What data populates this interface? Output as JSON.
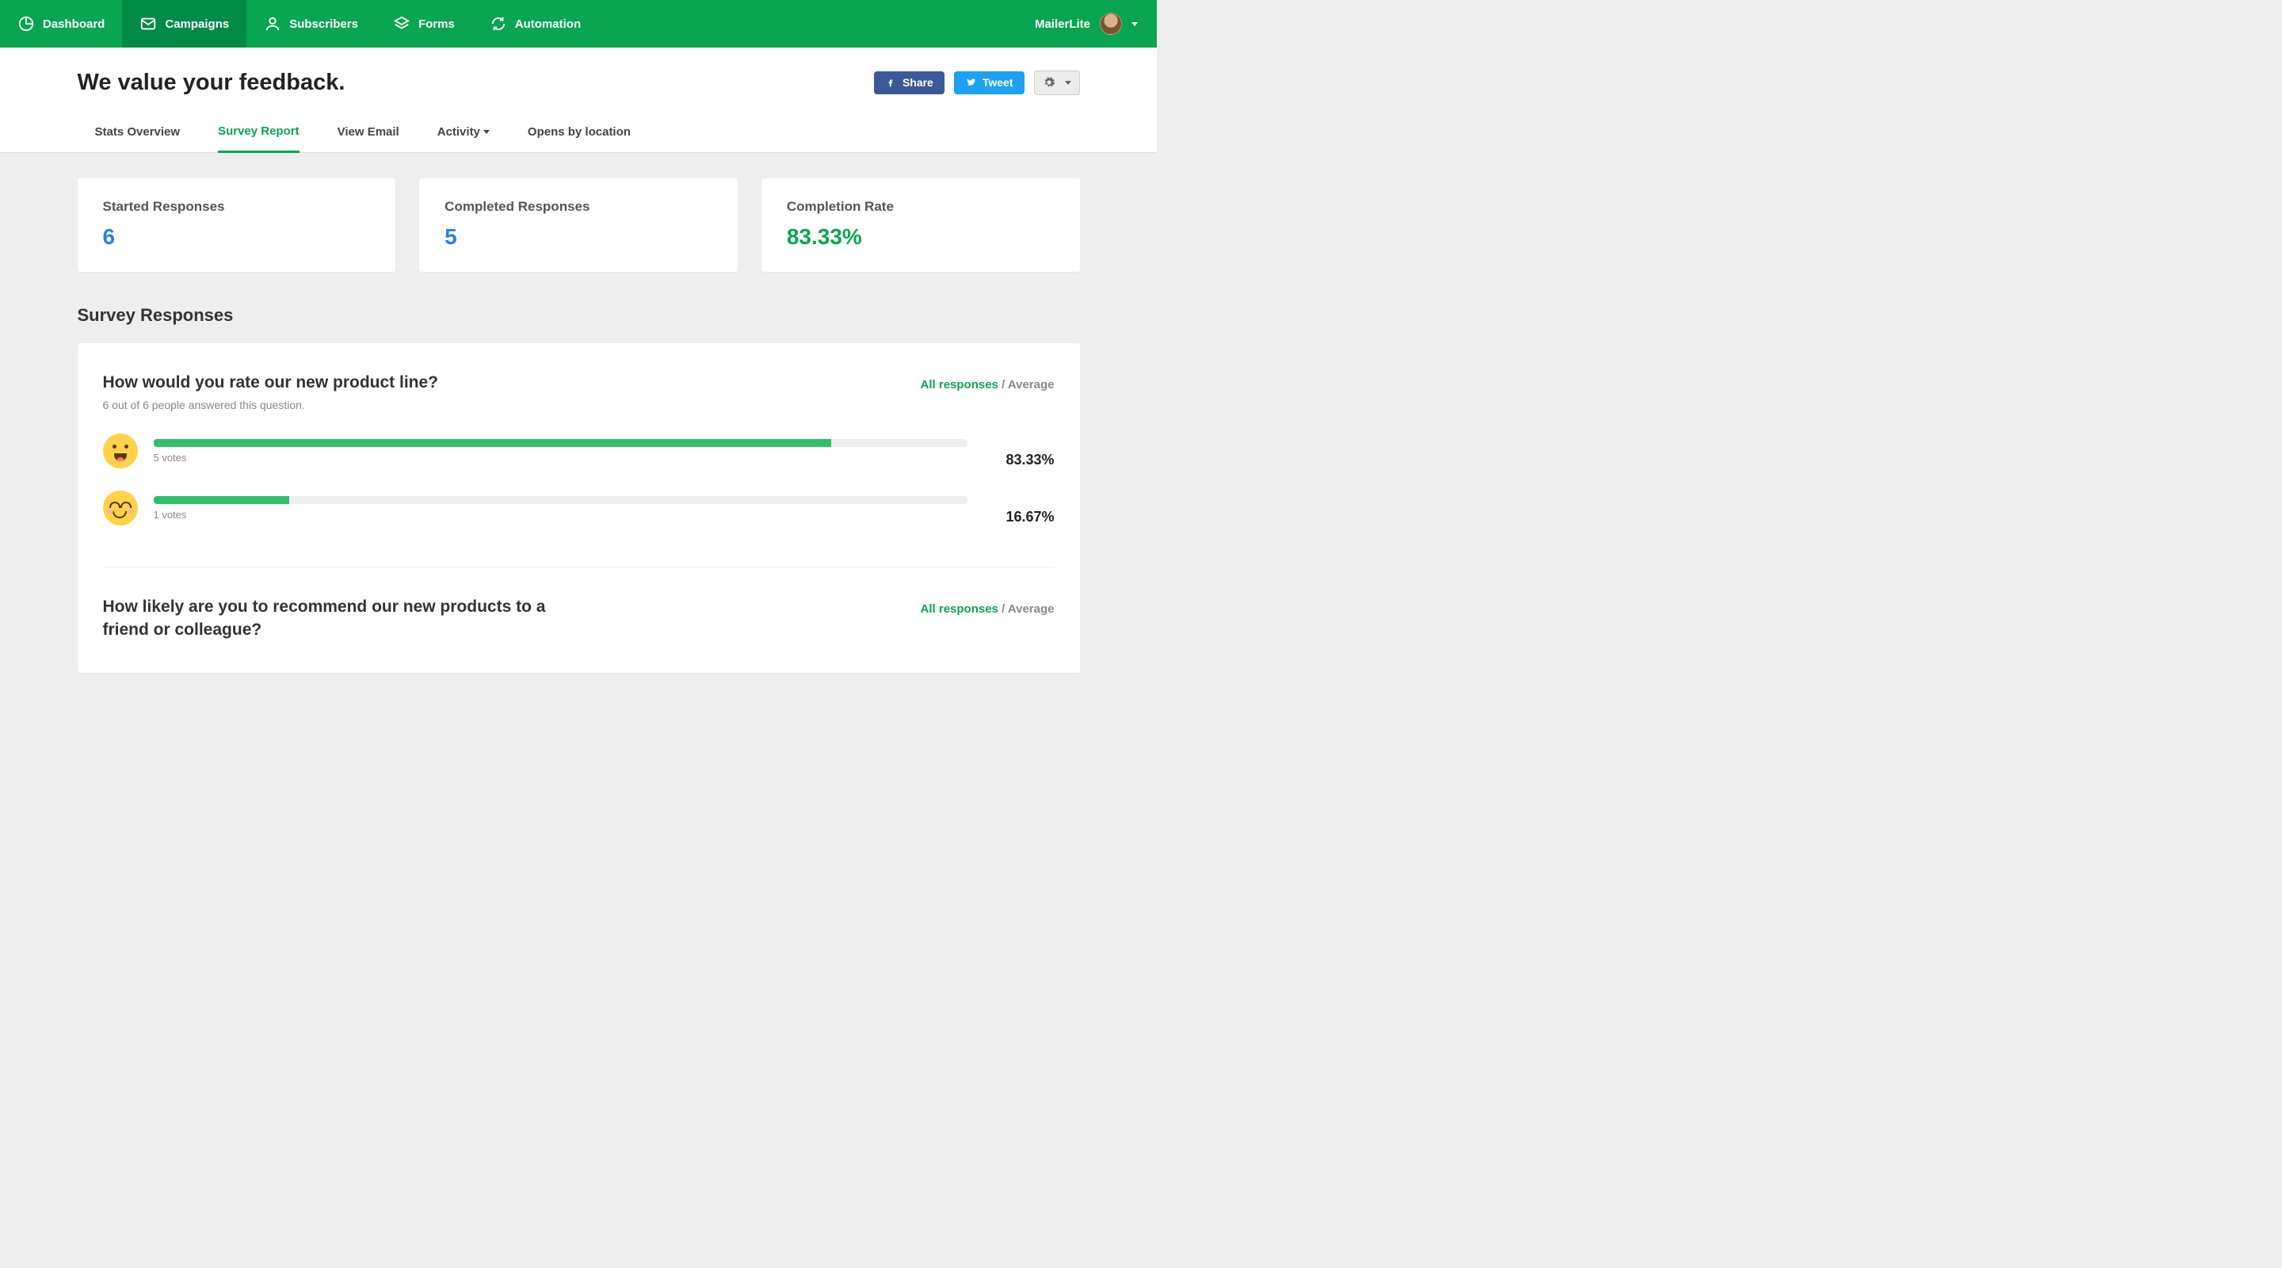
{
  "brand": "MailerLite",
  "nav": {
    "items": [
      {
        "label": "Dashboard"
      },
      {
        "label": "Campaigns"
      },
      {
        "label": "Subscribers"
      },
      {
        "label": "Forms"
      },
      {
        "label": "Automation"
      }
    ]
  },
  "page_title": "We value your feedback.",
  "actions": {
    "share": "Share",
    "tweet": "Tweet"
  },
  "tabs": [
    {
      "label": "Stats Overview"
    },
    {
      "label": "Survey Report"
    },
    {
      "label": "View Email"
    },
    {
      "label": "Activity"
    },
    {
      "label": "Opens by location"
    }
  ],
  "stats": {
    "started": {
      "label": "Started Responses",
      "value": "6"
    },
    "completed": {
      "label": "Completed Responses",
      "value": "5"
    },
    "rate": {
      "label": "Completion Rate",
      "value": "83.33%"
    }
  },
  "section_title": "Survey Responses",
  "toggle": {
    "all": "All responses",
    "avg": "Average"
  },
  "questions": [
    {
      "title": "How would you rate our new product line?",
      "sub": "6 out of 6 people answered this question.",
      "rows": [
        {
          "votes": "5 votes",
          "pct": "83.33%",
          "width": "83.33%"
        },
        {
          "votes": "1 votes",
          "pct": "16.67%",
          "width": "16.67%"
        }
      ]
    },
    {
      "title": "How likely are you to recommend our new products to a friend or colleague?",
      "sub": ""
    }
  ],
  "chart_data": {
    "type": "bar",
    "title": "How would you rate our new product line?",
    "categories": [
      "happy",
      "smile"
    ],
    "series": [
      {
        "name": "votes",
        "values": [
          5,
          1
        ]
      },
      {
        "name": "percent",
        "values": [
          83.33,
          16.67
        ]
      }
    ],
    "xlabel": "",
    "ylabel": "",
    "ylim": [
      0,
      100
    ]
  }
}
